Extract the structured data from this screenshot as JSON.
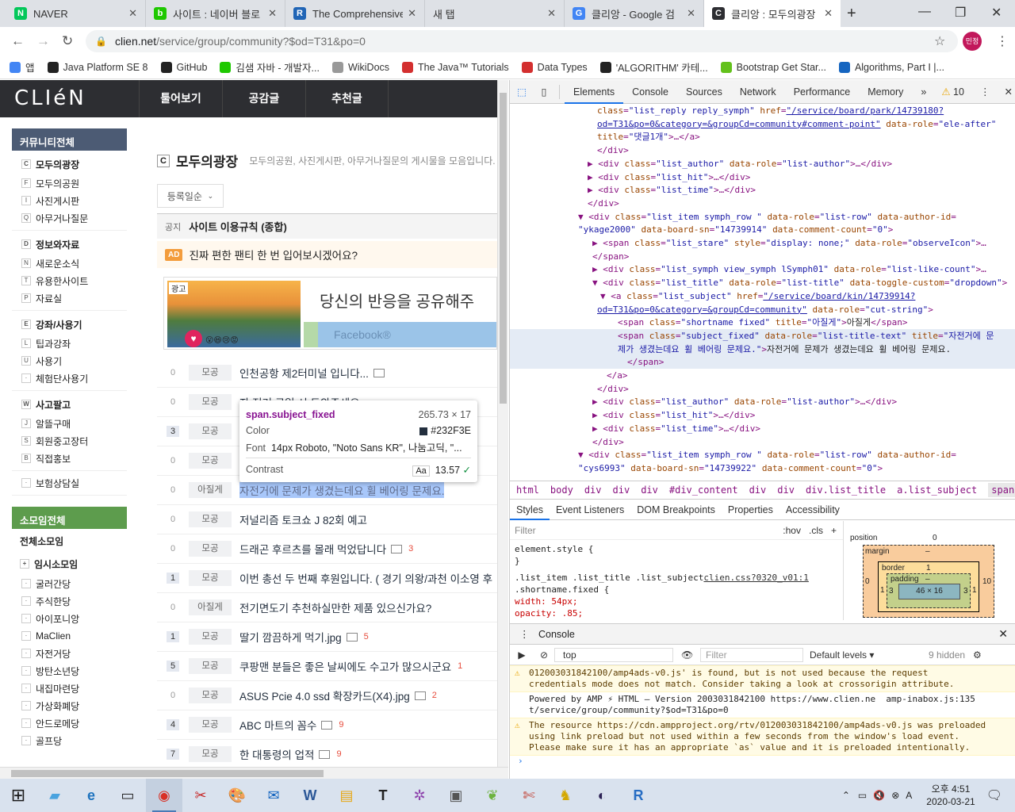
{
  "browser": {
    "tabs": [
      {
        "title": "NAVER",
        "color": "#03c75a",
        "glyph": "N"
      },
      {
        "title": "사이트 : 네이버 블로",
        "color": "#1ec800",
        "glyph": "b"
      },
      {
        "title": "The Comprehensive",
        "color": "#2165b6",
        "glyph": "R"
      },
      {
        "title": "새 탭",
        "color": "",
        "glyph": ""
      },
      {
        "title": "클리앙 - Google 검",
        "color": "#4285f4",
        "glyph": "G"
      },
      {
        "title": "클리앙 : 모두의광장",
        "color": "#2d2e32",
        "glyph": "C"
      }
    ],
    "url_host": "clien.net",
    "url_path": "/service/group/community?$od=T31&po=0",
    "profile": "민정",
    "bookmarks": [
      "앱",
      "Java Platform SE 8",
      "GitHub",
      "김샘 자바 - 개발자...",
      "WikiDocs",
      "The Java™ Tutorials",
      "Data Types",
      "'ALGORITHM' 카테...",
      "Bootstrap Get Star...",
      "Algorithms, Part I |..."
    ]
  },
  "site": {
    "logo": "CLIéN",
    "menu": [
      "툴어보기",
      "공감글",
      "추천글"
    ],
    "sidebar": {
      "community_head": "커뮤니티전체",
      "groups": [
        {
          "head": {
            "k": "C",
            "label": "모두의광장"
          },
          "items": [
            {
              "k": "F",
              "label": "모두의공원"
            },
            {
              "k": "I",
              "label": "사진게시판"
            },
            {
              "k": "Q",
              "label": "아무거나질문"
            }
          ]
        },
        {
          "head": {
            "k": "D",
            "label": "정보와자료"
          },
          "items": [
            {
              "k": "N",
              "label": "새로운소식"
            },
            {
              "k": "T",
              "label": "유용한사이트"
            },
            {
              "k": "P",
              "label": "자료실"
            }
          ]
        },
        {
          "head": {
            "k": "E",
            "label": "강좌/사용기"
          },
          "items": [
            {
              "k": "L",
              "label": "팁과강좌"
            },
            {
              "k": "U",
              "label": "사용기"
            },
            {
              "k": "·",
              "label": "체험단사용기"
            }
          ]
        },
        {
          "head": {
            "k": "W",
            "label": "사고팔고"
          },
          "items": [
            {
              "k": "J",
              "label": "알뜰구매"
            },
            {
              "k": "S",
              "label": "회원중고장터"
            },
            {
              "k": "B",
              "label": "직접홍보"
            }
          ]
        },
        {
          "head": null,
          "items": [
            {
              "k": "·",
              "label": "보험상담실"
            }
          ]
        }
      ],
      "somoim_head": "소모임전체",
      "somoim_all": "전체소모임",
      "somoim_temp": "임시소모임",
      "somoim_items": [
        "굴러간당",
        "주식한당",
        "아이포니앙",
        "MaClien",
        "자전거당",
        "방탄소년당",
        "내집마련당",
        "가상화폐당",
        "안드로메당",
        "골프당"
      ]
    },
    "board": {
      "icon": "C",
      "title": "모두의광장",
      "desc": "모두의공원, 사진게시판, 아무거나질문의 게시물을 모음입니다.",
      "sort": "등록일순",
      "notice_tag": "공지",
      "notice": "사이트 이용규칙 (종합)",
      "ad_tag": "AD",
      "ad_text": "진짜 편한 팬티 한 번 입어보시겠어요?",
      "ad_label": "광고",
      "ad_headline": "당신의 반응을 공유해주",
      "ad_cta": "Facebook®",
      "posts": [
        {
          "cnt": "0",
          "cat": "모공",
          "subj": "인천공항 제2터미널 입니다...",
          "pic": true,
          "rc": ""
        },
        {
          "cnt": "0",
          "cat": "모공",
          "subj": "자 전거 구입 시 도와주세요",
          "pic": false,
          "rc": ""
        },
        {
          "cnt": "3",
          "cat": "모공",
          "subj": "",
          "pic": false,
          "rc": ""
        },
        {
          "cnt": "0",
          "cat": "모공",
          "subj": "",
          "pic": false,
          "rc": ""
        },
        {
          "cnt": "0",
          "cat": "아질게",
          "subj": "자전거에 문제가 생겼는데요 휠 베어링 문제요.",
          "pic": false,
          "rc": "",
          "sel": true
        },
        {
          "cnt": "0",
          "cat": "모공",
          "subj": "저널리즘 토크쇼 J 82회 예고",
          "pic": false,
          "rc": ""
        },
        {
          "cnt": "0",
          "cat": "모공",
          "subj": "드래곤 후르츠를 몰래 먹었답니다",
          "pic": true,
          "rc": "3"
        },
        {
          "cnt": "1",
          "cat": "모공",
          "subj": "이번 총선 두 번째 후원입니다. ( 경기 의왕/과천 이소영 후",
          "pic": false,
          "rc": ""
        },
        {
          "cnt": "0",
          "cat": "아질게",
          "subj": "전기면도기 추천하실만한 제품 있으신가요?",
          "pic": false,
          "rc": ""
        },
        {
          "cnt": "1",
          "cat": "모공",
          "subj": "딸기 깜끔하게 먹기.jpg",
          "pic": true,
          "rc": "5"
        },
        {
          "cnt": "5",
          "cat": "모공",
          "subj": "쿠팡맨 분들은 좋은 날씨에도 수고가 많으시군요",
          "pic": false,
          "rc": "1"
        },
        {
          "cnt": "0",
          "cat": "모공",
          "subj": "ASUS Pcie 4.0 ssd 확장카드(X4).jpg",
          "pic": true,
          "rc": "2"
        },
        {
          "cnt": "4",
          "cat": "모공",
          "subj": "ABC 마트의 꼼수",
          "pic": true,
          "rc": "9"
        },
        {
          "cnt": "7",
          "cat": "모공",
          "subj": "한 대통령의 업적",
          "pic": true,
          "rc": "9"
        }
      ]
    },
    "tooltip": {
      "selector": "span.subject_fixed",
      "size": "265.73 × 17",
      "color_label": "Color",
      "color_value": "#232F3E",
      "font_label": "Font",
      "font_value": "14px Roboto, \"Noto Sans KR\", 나눔고딕, \"...",
      "contrast_label": "Contrast",
      "contrast_value": "13.57"
    }
  },
  "devtools": {
    "tabs": [
      "Elements",
      "Console",
      "Sources",
      "Network",
      "Performance",
      "Memory",
      "»"
    ],
    "warnings": "10",
    "dom_lines": [
      {
        "ind": 110,
        "html": "<span class=\"an\">class</span>=<span class=\"av\">\"list_reply reply_symph\"</span> <span class=\"an\">href</span>=<span class=\"lk\">\"/service/board/park/14739180?</span>"
      },
      {
        "ind": 110,
        "html": "<span class=\"lk\">od=T31&amp;po=0&amp;category=&amp;groupCd=community#comment-point\"</span> <span class=\"an\">data-role</span>=<span class=\"av\">\"ele-after\"</span>"
      },
      {
        "ind": 110,
        "html": "<span class=\"an\">title</span>=<span class=\"av\">\"댓글1개\"</span>&gt;…&lt;/a&gt;"
      },
      {
        "ind": 110,
        "html": "&lt;/div&gt;"
      },
      {
        "ind": 98,
        "html": "▶ &lt;div <span class=\"an\">class</span>=<span class=\"av\">\"list_author\"</span> <span class=\"an\">data-role</span>=<span class=\"av\">\"list-author\"</span>&gt;…&lt;/div&gt;"
      },
      {
        "ind": 98,
        "html": "▶ &lt;div <span class=\"an\">class</span>=<span class=\"av\">\"list_hit\"</span>&gt;…&lt;/div&gt;"
      },
      {
        "ind": 98,
        "html": "▶ &lt;div <span class=\"an\">class</span>=<span class=\"av\">\"list_time\"</span>&gt;…&lt;/div&gt;"
      },
      {
        "ind": 98,
        "html": "&lt;/div&gt;"
      },
      {
        "ind": 86,
        "html": "▼ &lt;div <span class=\"an\">class</span>=<span class=\"av\">\"list_item symph_row  \"</span> <span class=\"an\">data-role</span>=<span class=\"av\">\"list-row\"</span> <span class=\"an\">data-author-id</span>="
      },
      {
        "ind": 86,
        "html": "<span class=\"av\">\"ykage2000\"</span> <span class=\"an\">data-board-sn</span>=<span class=\"av\">\"14739914\"</span> <span class=\"an\">data-comment-count</span>=<span class=\"av\">\"0\"</span>&gt;"
      },
      {
        "ind": 104,
        "html": "▶ &lt;span <span class=\"an\">class</span>=<span class=\"av\">\"list_stare\"</span> <span class=\"an\">style</span>=<span class=\"av\">\"display: none;\"</span> <span class=\"an\">data-role</span>=<span class=\"av\">\"observeIcon\"</span>&gt;…"
      },
      {
        "ind": 104,
        "html": "&lt;/span&gt;"
      },
      {
        "ind": 104,
        "html": "▶ &lt;div <span class=\"an\">class</span>=<span class=\"av\">\"list_symph view_symph lSymph01\"</span> <span class=\"an\">data-role</span>=<span class=\"av\">\"list-like-count\"</span>&gt;…"
      },
      {
        "ind": 104,
        "html": "▼ &lt;div <span class=\"an\">class</span>=<span class=\"av\">\"list_title\"</span> <span class=\"an\">data-role</span>=<span class=\"av\">\"list-title\"</span> <span class=\"an\">data-toggle-custom</span>=<span class=\"av\">\"dropdown\"</span>&gt;"
      },
      {
        "ind": 114,
        "html": "▼ &lt;a <span class=\"an\">class</span>=<span class=\"av\">\"list_subject\"</span> <span class=\"an\">href</span>=<span class=\"lk\">\"/service/board/kin/14739914?</span>"
      },
      {
        "ind": 110,
        "html": "<span class=\"lk\">od=T31&amp;po=0&amp;category=&amp;groupCd=community\"</span> <span class=\"an\">data-role</span>=<span class=\"av\">\"cut-string\"</span>&gt;"
      },
      {
        "ind": 136,
        "html": "&lt;span <span class=\"an\">class</span>=<span class=\"av\">\"shortname fixed\"</span> <span class=\"an\">title</span>=<span class=\"av\">\"아질게\"</span>&gt;<span class=\"tx\">아질게</span>&lt;/span&gt;"
      },
      {
        "ind": 136,
        "html": "&lt;span <span class=\"an\">class</span>=<span class=\"av\">\"subject_fixed\"</span> <span class=\"an\">data-role</span>=<span class=\"av\">\"list-title-text\"</span> <span class=\"an\">title</span>=<span class=\"av\">\"자전거에 문</span>",
        "hl": true
      },
      {
        "ind": 136,
        "html": "<span class=\"av\">제가 생겼는데요 휠 베어링 문제요.\"</span>&gt;<span class=\"tx\">자전거에 문제가 생겼는데요 휠 베어링 문제요.</span>",
        "hl": true
      },
      {
        "ind": 148,
        "html": "&lt;/span&gt;",
        "hl": true
      },
      {
        "ind": 122,
        "html": "&lt;/a&gt;"
      },
      {
        "ind": 110,
        "html": "&lt;/div&gt;"
      },
      {
        "ind": 104,
        "html": "▶ &lt;div <span class=\"an\">class</span>=<span class=\"av\">\"list_author\"</span> <span class=\"an\">data-role</span>=<span class=\"av\">\"list-author\"</span>&gt;…&lt;/div&gt;"
      },
      {
        "ind": 104,
        "html": "▶ &lt;div <span class=\"an\">class</span>=<span class=\"av\">\"list_hit\"</span>&gt;…&lt;/div&gt;"
      },
      {
        "ind": 104,
        "html": "▶ &lt;div <span class=\"an\">class</span>=<span class=\"av\">\"list_time\"</span>&gt;…&lt;/div&gt;"
      },
      {
        "ind": 104,
        "html": "&lt;/div&gt;"
      },
      {
        "ind": 86,
        "html": "▼ &lt;div <span class=\"an\">class</span>=<span class=\"av\">\"list_item symph_row  \"</span> <span class=\"an\">data-role</span>=<span class=\"av\">\"list-row\"</span> <span class=\"an\">data-author-id</span>="
      },
      {
        "ind": 86,
        "html": "<span class=\"av\">\"cys6993\"</span> <span class=\"an\">data-board-sn</span>=<span class=\"av\">\"14739922\"</span> <span class=\"an\">data-comment-count</span>=<span class=\"av\">\"0\"</span>&gt;"
      }
    ],
    "breadcrumb": [
      "html",
      "body",
      "div",
      "div",
      "div",
      "#div_content",
      "div",
      "div",
      "div.list_title",
      "a.list_subject",
      "span.shortname.fixed"
    ],
    "subtabs": [
      "Styles",
      "Event Listeners",
      "DOM Breakpoints",
      "Properties",
      "Accessibility"
    ],
    "styles": {
      "filter_placeholder": "Filter",
      "hov": ":hov",
      "cls": ".cls",
      "lines": [
        "element.style {",
        "}",
        ".list_item .list_title .list_subject",
        ".shortname.fixed {",
        "  width: 54px;",
        "  opacity: .85;"
      ],
      "source": "clien.css?0320_v01:1"
    },
    "boxmodel": {
      "position": "position",
      "pos_val": "0",
      "margin": "margin",
      "border": "border",
      "border_val": "1",
      "padding": "padding",
      "padding_val": "–",
      "content": "46 × 16",
      "left": "1",
      "right": "1",
      "p_left": "3",
      "p_right": "3",
      "m_left": "0",
      "m_right": "10",
      "m_right2": "0",
      "dash": "–"
    },
    "console": {
      "title": "Console",
      "context": "top",
      "filter_placeholder": "Filter",
      "levels": "Default levels ▾",
      "hidden": "9 hidden",
      "messages": [
        {
          "type": "warn",
          "text": "012003031842100/amp4ads-v0.js' is found, but is not used because the request\ncredentials mode does not match. Consider taking a look at crossorigin attribute."
        },
        {
          "type": "log",
          "text": "Powered by AMP ⚡ HTML – Version 2003031842100 https://www.clien.ne  amp-inabox.js:135\nt/service/group/community?$od=T31&po=0"
        },
        {
          "type": "warn",
          "text": "The resource https://cdn.ampproject.org/rtv/012003031842100/amp4ads-v0.js was preloaded\nusing link preload but not used within a few seconds from the window's load event.\nPlease make sure it has an appropriate `as` value and it is preloaded intentionally."
        }
      ],
      "prompt": "›"
    }
  },
  "taskbar": {
    "time": "오후 4:51",
    "date": "2020-03-21",
    "ime": "A"
  }
}
